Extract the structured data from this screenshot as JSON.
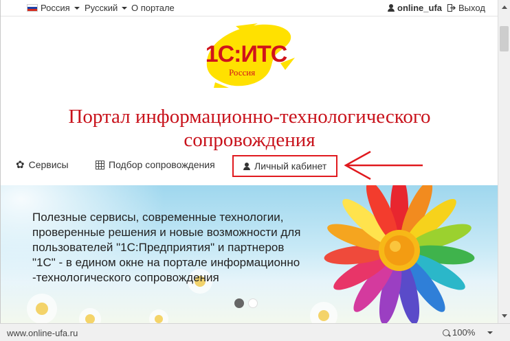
{
  "topbar": {
    "region_label": "Россия",
    "language_label": "Русский",
    "about_label": "О портале",
    "username": "online_ufa",
    "logout_label": "Выход"
  },
  "logo": {
    "brand": "1С:ИТС",
    "subtitle": "Россия",
    "colors": {
      "red": "#d0131b",
      "yellow": "#ffe100"
    }
  },
  "headline": {
    "line1": "Портал информационно-технологического",
    "line2": "сопровождения",
    "color": "#c8121b"
  },
  "nav": {
    "items": [
      {
        "label": "Сервисы",
        "icon": "flower-icon"
      },
      {
        "label": "Подбор сопровождения",
        "icon": "grid-icon"
      },
      {
        "label": "Личный кабинет",
        "icon": "user-icon",
        "highlighted": true
      }
    ],
    "highlight_color": "#e0191e"
  },
  "banner": {
    "text_lines": [
      "Полезные сервисы, современные технологии,",
      "проверенные решения и новые возможности для",
      "пользователей \"1С:Предприятия\" и партнеров",
      "\"1С\" - в едином окне на портале информационно",
      "-технологического сопровождения"
    ],
    "slides_total": 2,
    "active_slide": 1
  },
  "statusbar": {
    "url": "www.online-ufa.ru",
    "zoom": "100%"
  }
}
